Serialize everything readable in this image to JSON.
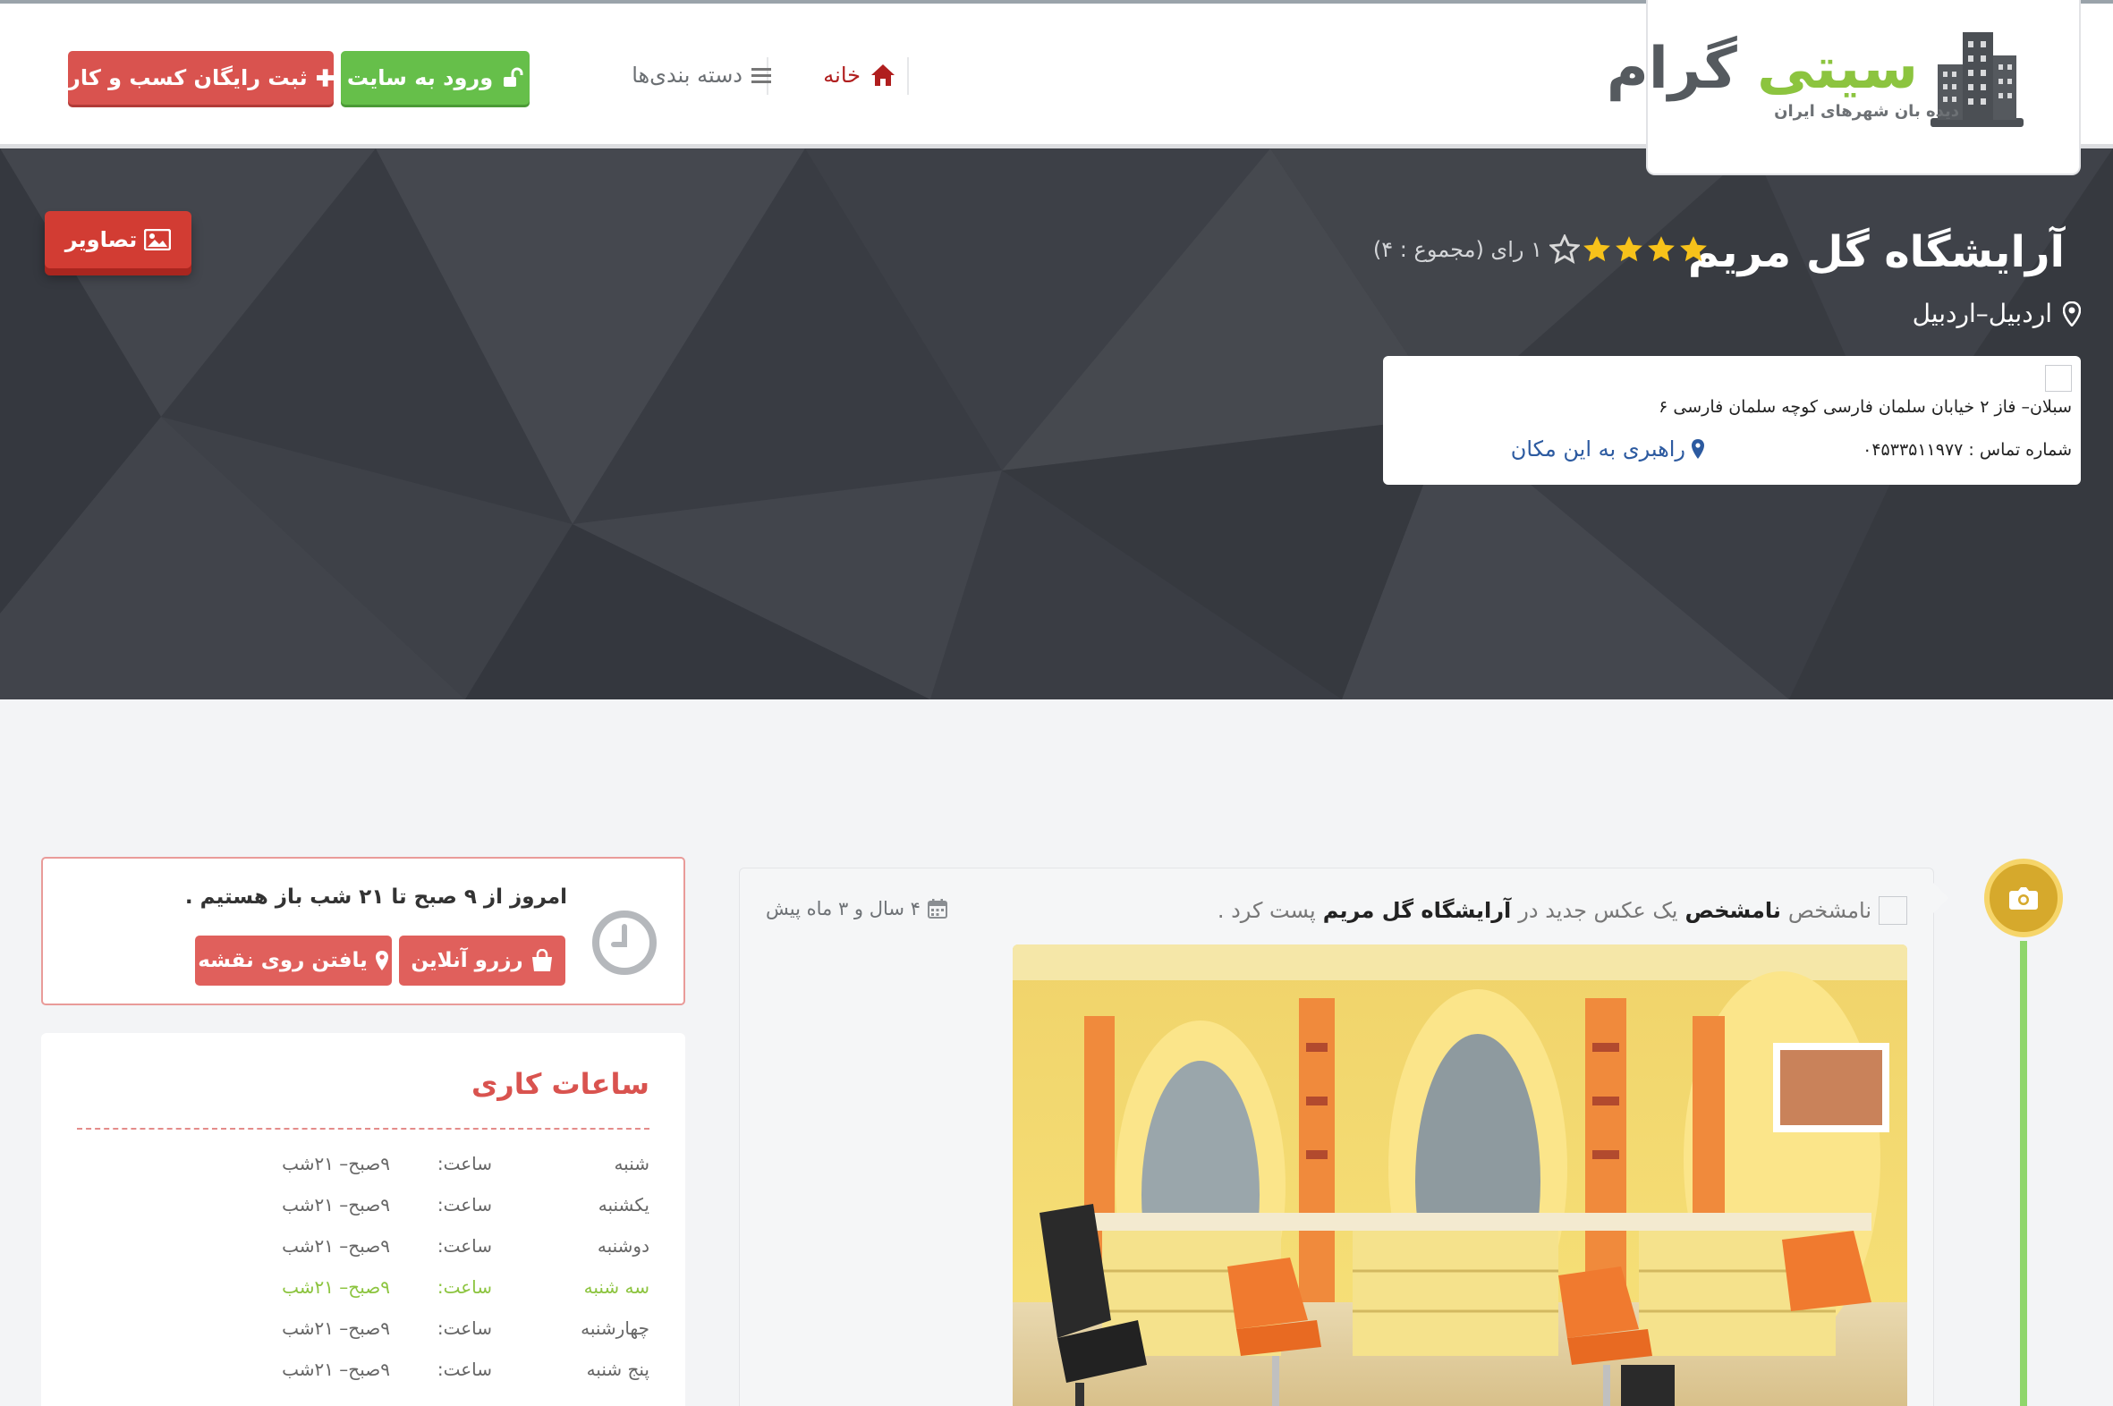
{
  "brand": {
    "logo_title_green": "سیتی",
    "logo_title_gray": "گرام",
    "logo_subtitle": "دیده بان شهرهای ایران",
    "colors": {
      "green": "#8cc43f",
      "red": "#d9534f",
      "dark": "#3b3e45"
    }
  },
  "nav": {
    "home_label": "خانه",
    "categories_label": "دسته بندی‌ها",
    "login_label": "ورود به سایت",
    "register_label": "ثبت رایگان کسب و کار"
  },
  "business": {
    "name": "آرایشگاه گل مریم",
    "rating": {
      "stars": 4,
      "max_stars": 5,
      "votes_text": "۱ رای (مجموع : ۴)"
    },
    "location": "اردبیل–اردبیل",
    "gallery_label": "تصاویر",
    "address": "سبلان– فاز ۲ خیابان سلمان فارسی کوچه سلمان فارسی ۶",
    "phone": "شماره تماس : ۰۴۵۳۳۵۱۱۹۷۷",
    "directions_label": "راهبری به این مکان"
  },
  "post": {
    "author": "نامشخص",
    "author_img_alt": "نامشخص",
    "text_prefix": "یک عکس جدید در",
    "place": "آرایشگاه گل مریم",
    "text_suffix": "پست کرد .",
    "date": "۴ سال و ۳ ماه پیش"
  },
  "open_status": {
    "text": "امروز از ۹ صبح تا ۲۱ شب باز   هستیم .",
    "reserve_label": "رزرو آنلاین",
    "map_label": "یافتن روی نقشه"
  },
  "hours": {
    "title": "ساعات کاری",
    "rows": [
      {
        "day": "شنبه",
        "label": "ساعت:",
        "time": "۹صبح– ۲۱شب",
        "today": false
      },
      {
        "day": "یکشنبه",
        "label": "ساعت:",
        "time": "۹صبح– ۲۱شب",
        "today": false
      },
      {
        "day": "دوشنبه",
        "label": "ساعت:",
        "time": "۹صبح– ۲۱شب",
        "today": false
      },
      {
        "day": "سه شنبه",
        "label": "ساعت:",
        "time": "۹صبح– ۲۱شب",
        "today": true
      },
      {
        "day": "چهارشنبه",
        "label": "ساعت:",
        "time": "۹صبح– ۲۱شب",
        "today": false
      },
      {
        "day": "پنج شنبه",
        "label": "ساعت:",
        "time": "۹صبح– ۲۱شب",
        "today": false
      }
    ]
  }
}
